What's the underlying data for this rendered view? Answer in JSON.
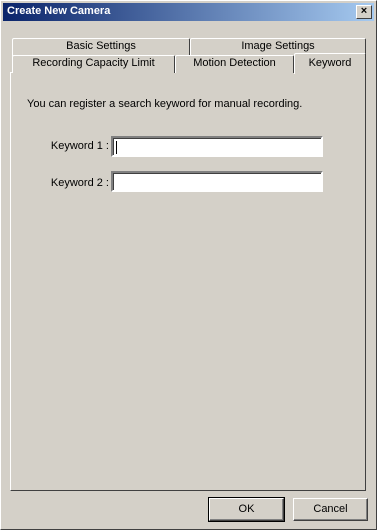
{
  "window": {
    "title": "Create New Camera",
    "close_glyph": "×"
  },
  "tabs": {
    "row_back": [
      {
        "label": "Basic Settings"
      },
      {
        "label": "Image Settings"
      }
    ],
    "row_front": [
      {
        "label": "Recording Capacity Limit"
      },
      {
        "label": "Motion Detection"
      },
      {
        "label": "Keyword",
        "active": true
      }
    ]
  },
  "keyword_tab": {
    "intro": "You can register a search keyword for manual recording.",
    "fields": [
      {
        "label": "Keyword 1 :",
        "value": ""
      },
      {
        "label": "Keyword 2 :",
        "value": ""
      }
    ]
  },
  "buttons": {
    "ok": "OK",
    "cancel": "Cancel"
  }
}
